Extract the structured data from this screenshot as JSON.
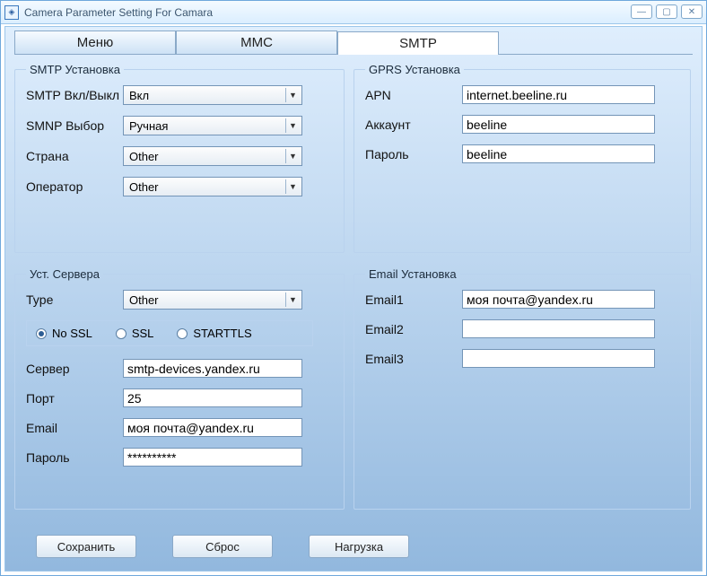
{
  "window": {
    "title": "Camera Parameter Setting For  Camara"
  },
  "tabs": {
    "menu": "Меню",
    "mmc": "MMC",
    "smtp": "SMTP"
  },
  "groups": {
    "smtp_setup": "SMTP Установка",
    "gprs_setup": "GPRS Установка",
    "server_setup": "Уст. Сервера",
    "email_setup": "Email Установка"
  },
  "smtp": {
    "onoff_label": "SMTP Вкл/Выкл",
    "onoff_value": "Вкл",
    "select_label": "SMNP Выбор",
    "select_value": "Ручная",
    "country_label": "Страна",
    "country_value": "Other",
    "operator_label": "Оператор",
    "operator_value": "Other"
  },
  "gprs": {
    "apn_label": "APN",
    "apn_value": "internet.beeline.ru",
    "account_label": "Аккаунт",
    "account_value": "beeline",
    "password_label": "Пароль",
    "password_value": "beeline"
  },
  "server": {
    "type_label": "Type",
    "type_value": "Other",
    "radio_nossl": "No SSL",
    "radio_ssl": "SSL",
    "radio_starttls": "STARTTLS",
    "server_label": "Сервер",
    "server_value": "smtp-devices.yandex.ru",
    "port_label": "Порт",
    "port_value": "25",
    "email_label": "Email",
    "email_value": "моя почта@yandex.ru",
    "password_label": "Пароль",
    "password_value": "**********"
  },
  "email": {
    "email1_label": "Email1",
    "email1_value": "моя почта@yandex.ru",
    "email2_label": "Email2",
    "email2_value": "",
    "email3_label": "Email3",
    "email3_value": ""
  },
  "buttons": {
    "save": "Сохранить",
    "reset": "Сброс",
    "load": "Нагрузка"
  }
}
